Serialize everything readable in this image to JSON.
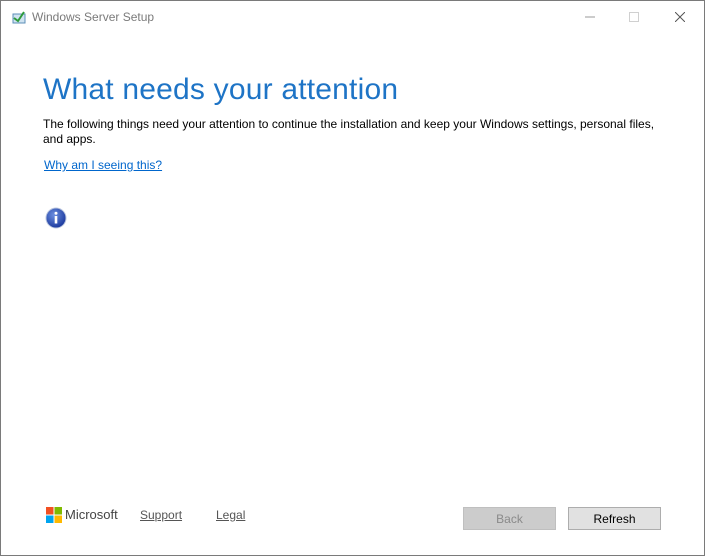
{
  "window": {
    "title": "Windows Server Setup",
    "icon": "setup-app-icon"
  },
  "main": {
    "heading": "What needs your attention",
    "description": "The following things need your attention to continue the installation and keep your Windows settings, personal files, and apps.",
    "why_link": "Why am I seeing this?",
    "info_icon": "info-icon"
  },
  "footer": {
    "brand": "Microsoft",
    "support_link": "Support",
    "legal_link": "Legal",
    "back_button": "Back",
    "refresh_button": "Refresh"
  },
  "colors": {
    "heading": "#1e74c6",
    "link": "#0066cc",
    "back_disabled_bg": "#cccccc",
    "refresh_bg": "#e1e1e1"
  }
}
